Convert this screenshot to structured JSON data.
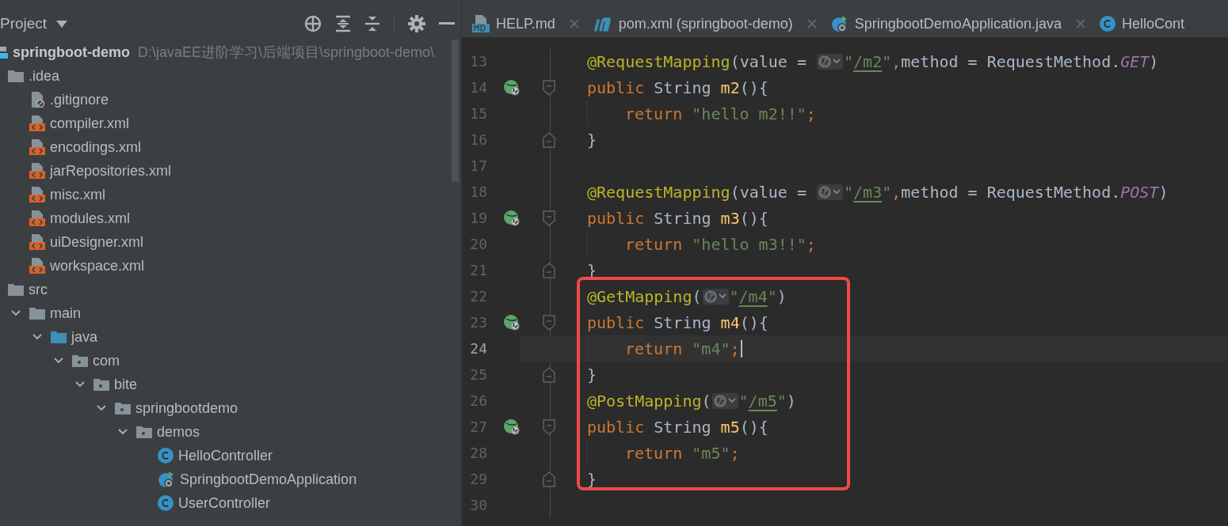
{
  "project_panel": {
    "title": "Project",
    "tree": [
      {
        "name": "springboot-demo",
        "path": "D:\\javaEE进阶学习\\后端项目\\springboot-demo\\",
        "kind": "module",
        "children": [
          {
            "name": ".idea",
            "kind": "folder",
            "children": [
              {
                "name": ".gitignore",
                "kind": "ignore"
              },
              {
                "name": "compiler.xml",
                "kind": "xml"
              },
              {
                "name": "encodings.xml",
                "kind": "xml"
              },
              {
                "name": "jarRepositories.xml",
                "kind": "xml"
              },
              {
                "name": "misc.xml",
                "kind": "xml"
              },
              {
                "name": "modules.xml",
                "kind": "xml"
              },
              {
                "name": "uiDesigner.xml",
                "kind": "xml"
              },
              {
                "name": "workspace.xml",
                "kind": "xml"
              }
            ]
          },
          {
            "name": "src",
            "kind": "folder",
            "children": [
              {
                "name": "main",
                "kind": "folder",
                "expanded": true,
                "children": [
                  {
                    "name": "java",
                    "kind": "source",
                    "expanded": true,
                    "children": [
                      {
                        "name": "com",
                        "kind": "package",
                        "expanded": true,
                        "children": [
                          {
                            "name": "bite",
                            "kind": "package",
                            "expanded": true,
                            "children": [
                              {
                                "name": "springbootdemo",
                                "kind": "package",
                                "expanded": true,
                                "children": [
                                  {
                                    "name": "demos",
                                    "kind": "package",
                                    "expanded": true,
                                    "children": [
                                      {
                                        "name": "HelloController",
                                        "kind": "class"
                                      },
                                      {
                                        "name": "SpringbootDemoApplication",
                                        "kind": "app"
                                      },
                                      {
                                        "name": "UserController",
                                        "kind": "class"
                                      }
                                    ]
                                  }
                                ]
                              }
                            ]
                          }
                        ]
                      }
                    ]
                  }
                ]
              }
            ]
          }
        ]
      }
    ]
  },
  "editor": {
    "tabs": [
      {
        "label": "HELP.md",
        "kind": "md"
      },
      {
        "label": "pom.xml (springboot-demo)",
        "kind": "maven"
      },
      {
        "label": "SpringbootDemoApplication.java",
        "kind": "app"
      },
      {
        "label": "HelloCont",
        "kind": "class"
      }
    ],
    "blocks": [
      {
        "boxed": false,
        "lines": [
          {
            "n": "13",
            "tokens": [
              {
                "kind": "ann",
                "t": "@RequestMapping"
              },
              {
                "kind": "plain",
                "t": "(value = "
              },
              {
                "kind": "inlay"
              },
              {
                "kind": "str",
                "t": "\""
              },
              {
                "kind": "link",
                "t": "/m2"
              },
              {
                "kind": "str",
                "t": "\""
              },
              {
                "kind": "punct",
                "t": ","
              },
              {
                "kind": "plain",
                "t": "method = RequestMethod."
              },
              {
                "kind": "const",
                "t": "GET"
              },
              {
                "kind": "plain",
                "t": ")"
              }
            ]
          },
          {
            "n": "14",
            "marker": {
              "kind": "endpoint"
            },
            "fold": {
              "kind": "start"
            },
            "tokens": [
              {
                "kind": "kw",
                "t": "public "
              },
              {
                "kind": "plain",
                "t": "String "
              },
              {
                "kind": "fn",
                "t": "m2"
              },
              {
                "kind": "plain",
                "t": "(){"
              }
            ]
          },
          {
            "n": "15",
            "indent": true,
            "tokens": [
              {
                "kind": "kw",
                "t": "return "
              },
              {
                "kind": "str",
                "t": "\"hello m2!!\""
              },
              {
                "kind": "punct",
                "t": ";"
              }
            ]
          },
          {
            "n": "16",
            "fold": {
              "kind": "end"
            },
            "tokens": [
              {
                "kind": "plain",
                "t": "}"
              }
            ]
          },
          {
            "n": "17"
          },
          {
            "n": "18",
            "tokens": [
              {
                "kind": "ann",
                "t": "@RequestMapping"
              },
              {
                "kind": "plain",
                "t": "(value = "
              },
              {
                "kind": "inlay"
              },
              {
                "kind": "str",
                "t": "\""
              },
              {
                "kind": "link",
                "t": "/m3"
              },
              {
                "kind": "str",
                "t": "\""
              },
              {
                "kind": "punct",
                "t": ","
              },
              {
                "kind": "plain",
                "t": "method = RequestMethod."
              },
              {
                "kind": "const",
                "t": "POST"
              },
              {
                "kind": "plain",
                "t": ")"
              }
            ]
          },
          {
            "n": "19",
            "marker": {
              "kind": "endpoint"
            },
            "fold": {
              "kind": "start"
            },
            "tokens": [
              {
                "kind": "kw",
                "t": "public "
              },
              {
                "kind": "plain",
                "t": "String "
              },
              {
                "kind": "fn",
                "t": "m3"
              },
              {
                "kind": "plain",
                "t": "(){"
              }
            ]
          },
          {
            "n": "20",
            "indent": true,
            "tokens": [
              {
                "kind": "kw",
                "t": "return "
              },
              {
                "kind": "str",
                "t": "\"hello m3!!\""
              },
              {
                "kind": "punct",
                "t": ";"
              }
            ]
          },
          {
            "n": "21",
            "fold": {
              "kind": "end"
            },
            "tokens": [
              {
                "kind": "plain",
                "t": "}"
              }
            ]
          }
        ]
      },
      {
        "boxed": true,
        "lines": [
          {
            "n": "22",
            "tokens": [
              {
                "kind": "ann",
                "t": "@GetMapping"
              },
              {
                "kind": "plain",
                "t": "("
              },
              {
                "kind": "inlay"
              },
              {
                "kind": "str",
                "t": "\""
              },
              {
                "kind": "link",
                "t": "/m4"
              },
              {
                "kind": "str",
                "t": "\""
              },
              {
                "kind": "plain",
                "t": ")"
              }
            ]
          },
          {
            "n": "23",
            "marker": {
              "kind": "endpoint"
            },
            "fold": {
              "kind": "start"
            },
            "tokens": [
              {
                "kind": "kw",
                "t": "public "
              },
              {
                "kind": "plain",
                "t": "String "
              },
              {
                "kind": "fn",
                "t": "m4"
              },
              {
                "kind": "plain",
                "t": "(){"
              }
            ]
          },
          {
            "n": "24",
            "current": true,
            "indent": true,
            "tokens": [
              {
                "kind": "kw",
                "t": "return "
              },
              {
                "kind": "str",
                "t": "\"m4\""
              },
              {
                "kind": "punct",
                "t": ";"
              }
            ]
          },
          {
            "n": "25",
            "fold": {
              "kind": "end"
            },
            "tokens": [
              {
                "kind": "plain",
                "t": "}"
              }
            ]
          },
          {
            "n": "26",
            "tokens": [
              {
                "kind": "ann",
                "t": "@PostMapping"
              },
              {
                "kind": "plain",
                "t": "("
              },
              {
                "kind": "inlay"
              },
              {
                "kind": "str",
                "t": "\""
              },
              {
                "kind": "link",
                "t": "/m5"
              },
              {
                "kind": "str",
                "t": "\""
              },
              {
                "kind": "plain",
                "t": ")"
              }
            ]
          },
          {
            "n": "27",
            "marker": {
              "kind": "endpoint"
            },
            "fold": {
              "kind": "start"
            },
            "tokens": [
              {
                "kind": "kw",
                "t": "public "
              },
              {
                "kind": "plain",
                "t": "String "
              },
              {
                "kind": "fn",
                "t": "m5"
              },
              {
                "kind": "plain",
                "t": "(){"
              }
            ]
          },
          {
            "n": "28",
            "indent": true,
            "tokens": [
              {
                "kind": "kw",
                "t": "return "
              },
              {
                "kind": "str",
                "t": "\"m5\""
              },
              {
                "kind": "punct",
                "t": ";"
              }
            ]
          },
          {
            "n": "29",
            "fold": {
              "kind": "end"
            },
            "tokens": [
              {
                "kind": "plain",
                "t": "}"
              }
            ]
          }
        ]
      },
      {
        "boxed": false,
        "lines": [
          {
            "n": "30"
          }
        ]
      }
    ]
  }
}
